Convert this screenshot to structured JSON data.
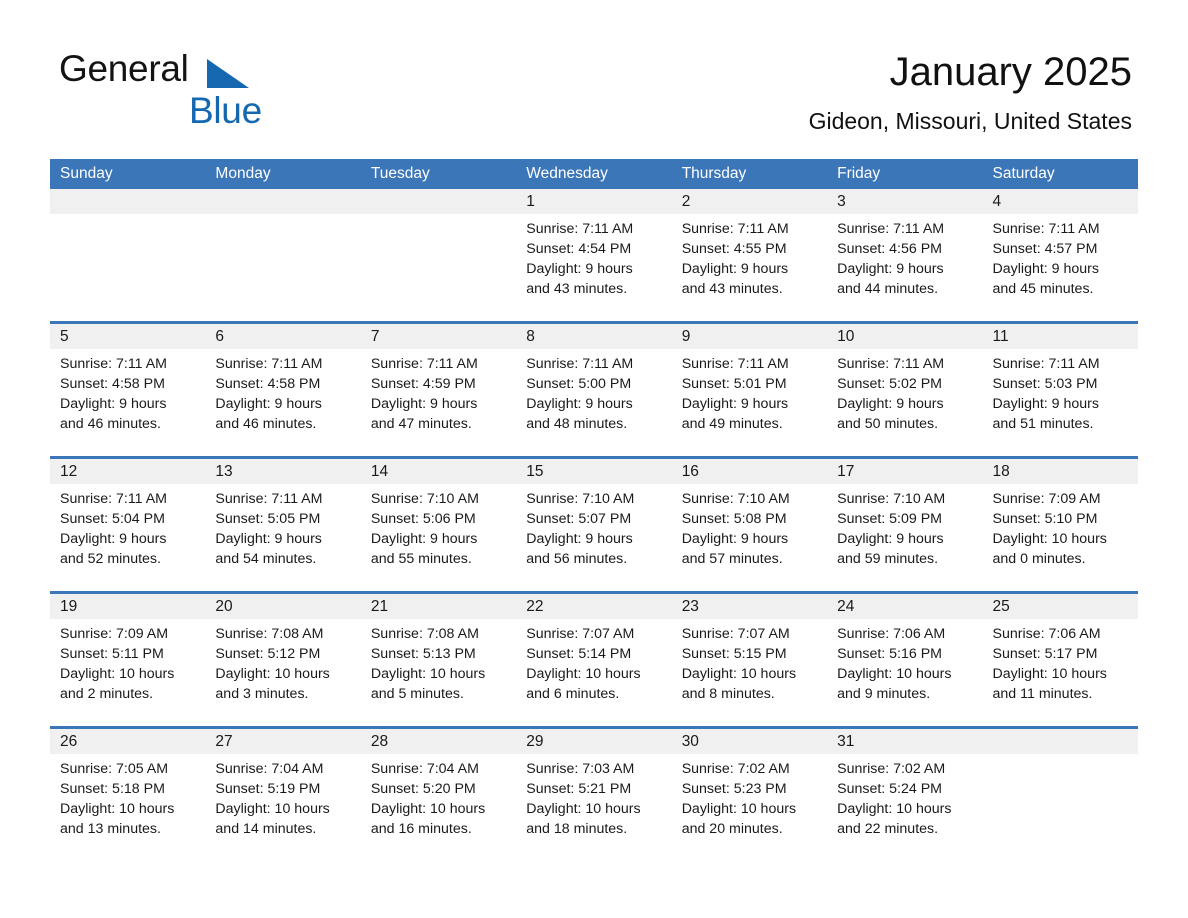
{
  "brand": {
    "word1": "General",
    "word2": "Blue",
    "triangle_color": "#1568b0"
  },
  "header": {
    "title": "January 2025",
    "location": "Gideon, Missouri, United States",
    "header_bg": "#3a76b8",
    "date_band_bg": "#f0f0f0"
  },
  "weekdays": [
    "Sunday",
    "Monday",
    "Tuesday",
    "Wednesday",
    "Thursday",
    "Friday",
    "Saturday"
  ],
  "weeks": [
    [
      {
        "day": "",
        "empty": true
      },
      {
        "day": "",
        "empty": true
      },
      {
        "day": "",
        "empty": true
      },
      {
        "day": "1",
        "sunrise": "Sunrise: 7:11 AM",
        "sunset": "Sunset: 4:54 PM",
        "daylight_line1": "Daylight: 9 hours",
        "daylight_line2": "and 43 minutes."
      },
      {
        "day": "2",
        "sunrise": "Sunrise: 7:11 AM",
        "sunset": "Sunset: 4:55 PM",
        "daylight_line1": "Daylight: 9 hours",
        "daylight_line2": "and 43 minutes."
      },
      {
        "day": "3",
        "sunrise": "Sunrise: 7:11 AM",
        "sunset": "Sunset: 4:56 PM",
        "daylight_line1": "Daylight: 9 hours",
        "daylight_line2": "and 44 minutes."
      },
      {
        "day": "4",
        "sunrise": "Sunrise: 7:11 AM",
        "sunset": "Sunset: 4:57 PM",
        "daylight_line1": "Daylight: 9 hours",
        "daylight_line2": "and 45 minutes."
      }
    ],
    [
      {
        "day": "5",
        "sunrise": "Sunrise: 7:11 AM",
        "sunset": "Sunset: 4:58 PM",
        "daylight_line1": "Daylight: 9 hours",
        "daylight_line2": "and 46 minutes."
      },
      {
        "day": "6",
        "sunrise": "Sunrise: 7:11 AM",
        "sunset": "Sunset: 4:58 PM",
        "daylight_line1": "Daylight: 9 hours",
        "daylight_line2": "and 46 minutes."
      },
      {
        "day": "7",
        "sunrise": "Sunrise: 7:11 AM",
        "sunset": "Sunset: 4:59 PM",
        "daylight_line1": "Daylight: 9 hours",
        "daylight_line2": "and 47 minutes."
      },
      {
        "day": "8",
        "sunrise": "Sunrise: 7:11 AM",
        "sunset": "Sunset: 5:00 PM",
        "daylight_line1": "Daylight: 9 hours",
        "daylight_line2": "and 48 minutes."
      },
      {
        "day": "9",
        "sunrise": "Sunrise: 7:11 AM",
        "sunset": "Sunset: 5:01 PM",
        "daylight_line1": "Daylight: 9 hours",
        "daylight_line2": "and 49 minutes."
      },
      {
        "day": "10",
        "sunrise": "Sunrise: 7:11 AM",
        "sunset": "Sunset: 5:02 PM",
        "daylight_line1": "Daylight: 9 hours",
        "daylight_line2": "and 50 minutes."
      },
      {
        "day": "11",
        "sunrise": "Sunrise: 7:11 AM",
        "sunset": "Sunset: 5:03 PM",
        "daylight_line1": "Daylight: 9 hours",
        "daylight_line2": "and 51 minutes."
      }
    ],
    [
      {
        "day": "12",
        "sunrise": "Sunrise: 7:11 AM",
        "sunset": "Sunset: 5:04 PM",
        "daylight_line1": "Daylight: 9 hours",
        "daylight_line2": "and 52 minutes."
      },
      {
        "day": "13",
        "sunrise": "Sunrise: 7:11 AM",
        "sunset": "Sunset: 5:05 PM",
        "daylight_line1": "Daylight: 9 hours",
        "daylight_line2": "and 54 minutes."
      },
      {
        "day": "14",
        "sunrise": "Sunrise: 7:10 AM",
        "sunset": "Sunset: 5:06 PM",
        "daylight_line1": "Daylight: 9 hours",
        "daylight_line2": "and 55 minutes."
      },
      {
        "day": "15",
        "sunrise": "Sunrise: 7:10 AM",
        "sunset": "Sunset: 5:07 PM",
        "daylight_line1": "Daylight: 9 hours",
        "daylight_line2": "and 56 minutes."
      },
      {
        "day": "16",
        "sunrise": "Sunrise: 7:10 AM",
        "sunset": "Sunset: 5:08 PM",
        "daylight_line1": "Daylight: 9 hours",
        "daylight_line2": "and 57 minutes."
      },
      {
        "day": "17",
        "sunrise": "Sunrise: 7:10 AM",
        "sunset": "Sunset: 5:09 PM",
        "daylight_line1": "Daylight: 9 hours",
        "daylight_line2": "and 59 minutes."
      },
      {
        "day": "18",
        "sunrise": "Sunrise: 7:09 AM",
        "sunset": "Sunset: 5:10 PM",
        "daylight_line1": "Daylight: 10 hours",
        "daylight_line2": "and 0 minutes."
      }
    ],
    [
      {
        "day": "19",
        "sunrise": "Sunrise: 7:09 AM",
        "sunset": "Sunset: 5:11 PM",
        "daylight_line1": "Daylight: 10 hours",
        "daylight_line2": "and 2 minutes."
      },
      {
        "day": "20",
        "sunrise": "Sunrise: 7:08 AM",
        "sunset": "Sunset: 5:12 PM",
        "daylight_line1": "Daylight: 10 hours",
        "daylight_line2": "and 3 minutes."
      },
      {
        "day": "21",
        "sunrise": "Sunrise: 7:08 AM",
        "sunset": "Sunset: 5:13 PM",
        "daylight_line1": "Daylight: 10 hours",
        "daylight_line2": "and 5 minutes."
      },
      {
        "day": "22",
        "sunrise": "Sunrise: 7:07 AM",
        "sunset": "Sunset: 5:14 PM",
        "daylight_line1": "Daylight: 10 hours",
        "daylight_line2": "and 6 minutes."
      },
      {
        "day": "23",
        "sunrise": "Sunrise: 7:07 AM",
        "sunset": "Sunset: 5:15 PM",
        "daylight_line1": "Daylight: 10 hours",
        "daylight_line2": "and 8 minutes."
      },
      {
        "day": "24",
        "sunrise": "Sunrise: 7:06 AM",
        "sunset": "Sunset: 5:16 PM",
        "daylight_line1": "Daylight: 10 hours",
        "daylight_line2": "and 9 minutes."
      },
      {
        "day": "25",
        "sunrise": "Sunrise: 7:06 AM",
        "sunset": "Sunset: 5:17 PM",
        "daylight_line1": "Daylight: 10 hours",
        "daylight_line2": "and 11 minutes."
      }
    ],
    [
      {
        "day": "26",
        "sunrise": "Sunrise: 7:05 AM",
        "sunset": "Sunset: 5:18 PM",
        "daylight_line1": "Daylight: 10 hours",
        "daylight_line2": "and 13 minutes."
      },
      {
        "day": "27",
        "sunrise": "Sunrise: 7:04 AM",
        "sunset": "Sunset: 5:19 PM",
        "daylight_line1": "Daylight: 10 hours",
        "daylight_line2": "and 14 minutes."
      },
      {
        "day": "28",
        "sunrise": "Sunrise: 7:04 AM",
        "sunset": "Sunset: 5:20 PM",
        "daylight_line1": "Daylight: 10 hours",
        "daylight_line2": "and 16 minutes."
      },
      {
        "day": "29",
        "sunrise": "Sunrise: 7:03 AM",
        "sunset": "Sunset: 5:21 PM",
        "daylight_line1": "Daylight: 10 hours",
        "daylight_line2": "and 18 minutes."
      },
      {
        "day": "30",
        "sunrise": "Sunrise: 7:02 AM",
        "sunset": "Sunset: 5:23 PM",
        "daylight_line1": "Daylight: 10 hours",
        "daylight_line2": "and 20 minutes."
      },
      {
        "day": "31",
        "sunrise": "Sunrise: 7:02 AM",
        "sunset": "Sunset: 5:24 PM",
        "daylight_line1": "Daylight: 10 hours",
        "daylight_line2": "and 22 minutes."
      },
      {
        "day": "",
        "empty": true
      }
    ]
  ]
}
